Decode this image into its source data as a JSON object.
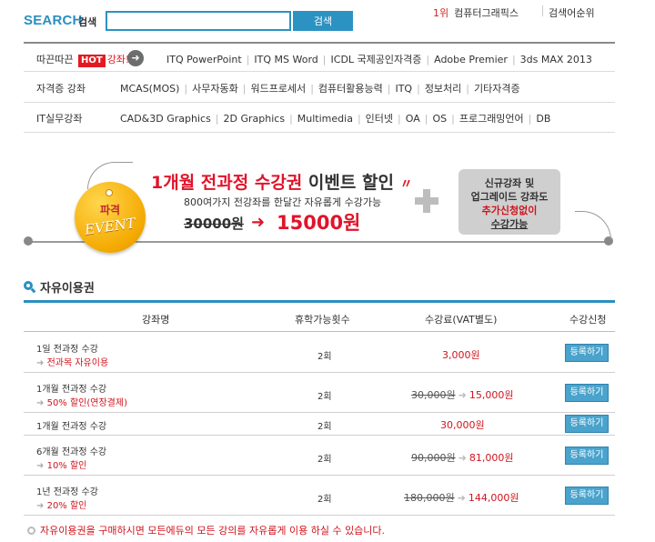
{
  "search": {
    "label": "SEARCH",
    "label_ko": "검색",
    "value": "",
    "button": "검색"
  },
  "ranking": {
    "rank": "1위",
    "item": "컴퓨터그래픽스",
    "link": "검색어순위"
  },
  "nav": {
    "hot_prefix": "따끈따끈",
    "hot_badge": "HOT",
    "hot_suffix": "강좌!",
    "hot_links": [
      "ITQ PowerPoint",
      "ITQ MS Word",
      "ICDL 국제공인자격증",
      "Adobe Premier",
      "3ds MAX 2013"
    ],
    "row2_head": "자격증 강좌",
    "row2_links": [
      "MCAS(MOS)",
      "사무자동화",
      "워드프로세서",
      "컴퓨터활용능력",
      "ITQ",
      "정보처리",
      "기타자격증"
    ],
    "row3_head": "IT실무강좌",
    "row3_links": [
      "CAD&3D Graphics",
      "2D Graphics",
      "Multimedia",
      "인터넷",
      "OA",
      "OS",
      "프로그래밍언어",
      "DB"
    ]
  },
  "banner": {
    "tag_line1": "파격",
    "tag_line2": "EVENT",
    "title_red": "1개월 전과정 수강권",
    "title_dark": "이벤트 할인",
    "subtitle": "800여가지 전강좌를 한달간 자유롭게 수강가능",
    "old_price": "30000원",
    "new_price": "15000원",
    "side_line1": "신규강좌 및",
    "side_line2": "업그레이드 강좌도",
    "side_line3": "추가신청없이",
    "side_line4": "수강가능"
  },
  "section": {
    "title": "자유이용권"
  },
  "table": {
    "headers": [
      "강좌명",
      "휴학가능횟수",
      "수강료(VAT별도)",
      "수강신청"
    ],
    "rows": [
      {
        "name": "1일 전과정 수강",
        "note": "전과목 자유이용",
        "count": "2회",
        "old_price": "",
        "price": "3,000원",
        "button": "등록하기"
      },
      {
        "name": "1개월 전과정 수강",
        "note": "50% 할인(연장결제)",
        "count": "2회",
        "old_price": "30,000원",
        "price": "15,000원",
        "button": "등록하기"
      },
      {
        "name": "1개월 전과정 수강",
        "note": "",
        "count": "2회",
        "old_price": "",
        "price": "30,000원",
        "button": "등록하기"
      },
      {
        "name": "6개월 전과정 수강",
        "note": "10% 할인",
        "count": "2회",
        "old_price": "90,000원",
        "price": "81,000원",
        "button": "등록하기"
      },
      {
        "name": "1년 전과정 수강",
        "note": "20% 할인",
        "count": "2회",
        "old_price": "180,000원",
        "price": "144,000원",
        "button": "등록하기"
      }
    ]
  },
  "footnote": "자유이용권을 구매하시면 모든에듀의 모든 강의를 자유롭게 이용 하실 수 있습니다.",
  "colors": {
    "accent": "#2a8fc0",
    "highlight": "#e0142b",
    "button": "#4aa3cc"
  }
}
